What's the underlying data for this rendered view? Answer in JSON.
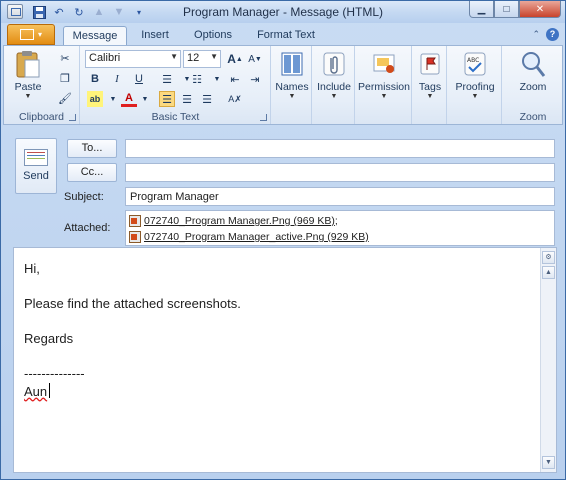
{
  "window": {
    "title": "Program Manager  -  Message (HTML)"
  },
  "tabs": [
    {
      "label": "Message",
      "active": true
    },
    {
      "label": "Insert",
      "active": false
    },
    {
      "label": "Options",
      "active": false
    },
    {
      "label": "Format Text",
      "active": false
    }
  ],
  "ribbon": {
    "clipboard": {
      "group_label": "Clipboard",
      "paste_label": "Paste"
    },
    "basic_text": {
      "group_label": "Basic Text",
      "font_name": "Calibri",
      "font_size": "12"
    },
    "names": {
      "label": "Names"
    },
    "include": {
      "label": "Include"
    },
    "permission": {
      "label": "Permission"
    },
    "tags": {
      "label": "Tags"
    },
    "proofing": {
      "label": "Proofing"
    },
    "zoom": {
      "label": "Zoom",
      "group_label": "Zoom"
    }
  },
  "compose": {
    "send_label": "Send",
    "to_button": "To...",
    "cc_button": "Cc...",
    "to_value": "",
    "cc_value": "",
    "subject_label": "Subject:",
    "subject_value": "Program Manager",
    "attached_label": "Attached:",
    "attachments": [
      {
        "link": "072740_Program Manager.Png (969 KB)",
        "suffix": ";"
      },
      {
        "link": "072740_Program Manager_active.Png (929 KB)",
        "suffix": ""
      }
    ]
  },
  "body": {
    "lines": [
      "Hi,",
      "",
      "Please find the attached screenshots.",
      "",
      "Regards",
      "",
      "--------------",
      "Aun"
    ]
  },
  "colors": {
    "file_tab": "#e28c12",
    "accent": "#2b56a0",
    "ribbon_bg": "#e6eef8"
  }
}
